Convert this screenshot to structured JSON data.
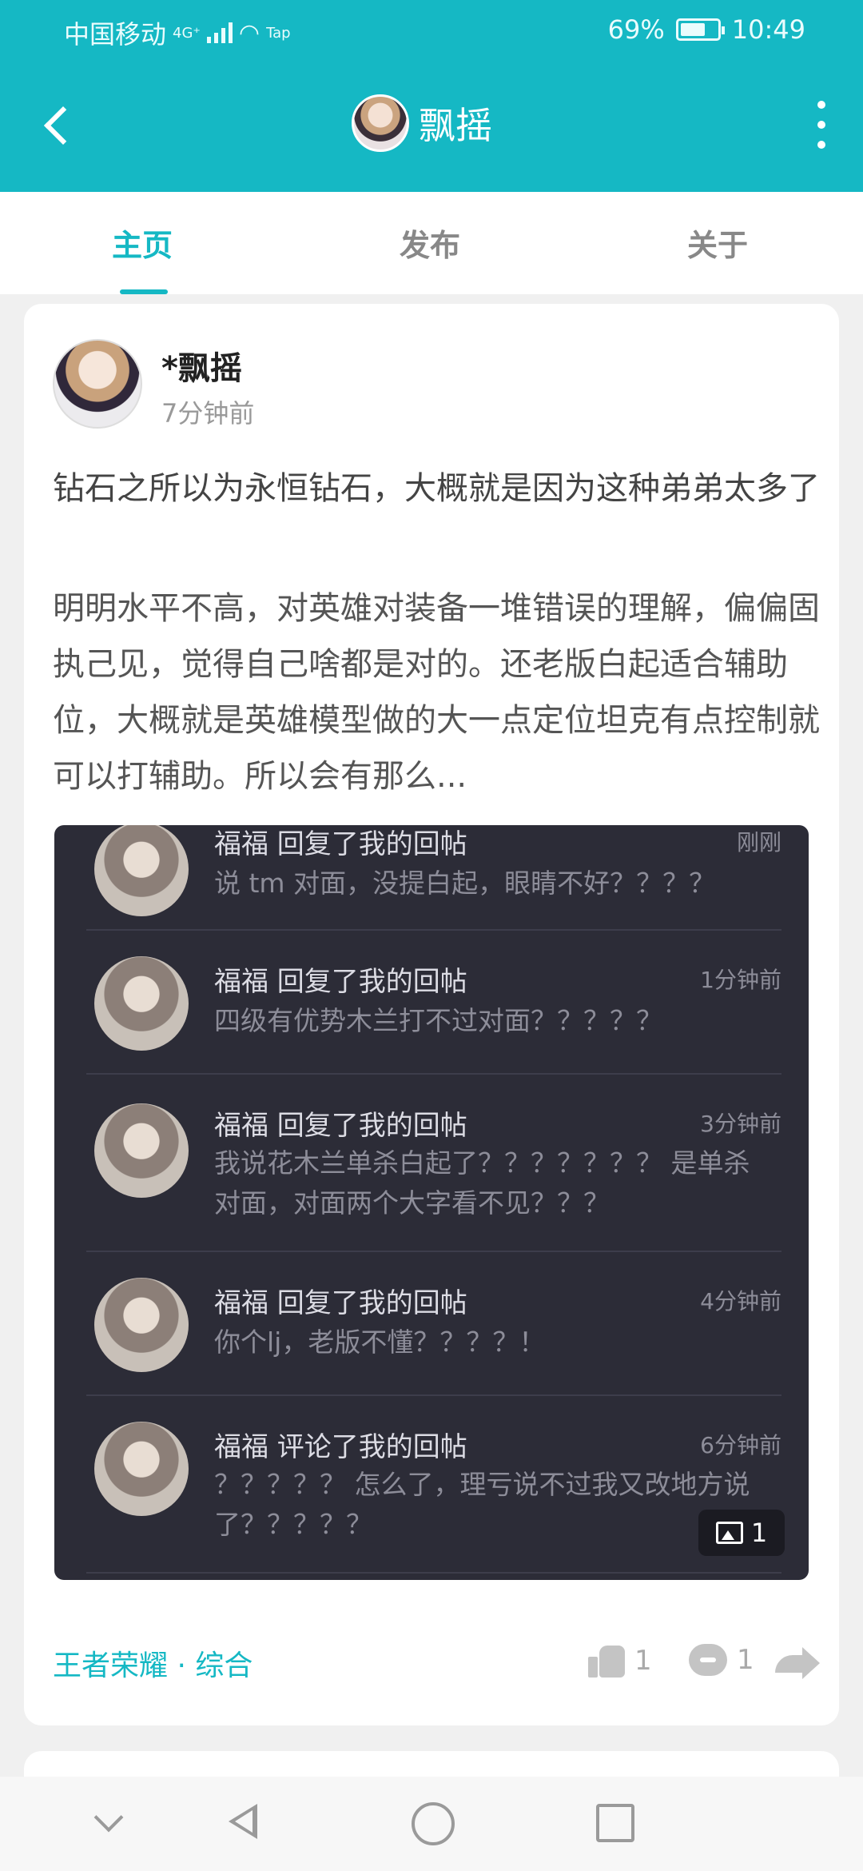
{
  "status_bar": {
    "carrier": "中国移动",
    "network": "4G⁺",
    "tap_label": "Tap",
    "battery_text": "69%",
    "battery_level": 0.69,
    "time": "10:49"
  },
  "app_bar": {
    "title": "飘摇",
    "back_icon": "chevron-left-icon",
    "more_icon": "more-vertical-icon"
  },
  "tabs": [
    {
      "label": "主页",
      "active": true
    },
    {
      "label": "发布",
      "active": false
    },
    {
      "label": "关于",
      "active": false
    }
  ],
  "post": {
    "author": "*飘摇",
    "time": "7分钟前",
    "title": "钻石之所以为永恒钻石，大概就是因为这种弟弟太多了",
    "body": "明明水平不高，对英雄对装备一堆错误的理解，偏偏固执己见，觉得自己啥都是对的。还老版白起适合辅助位，大概就是英雄模型做的大一点定位坦克有点控制就可以打辅助。所以会有那么...",
    "screenshot": {
      "items": [
        {
          "name": "福福 回复了我的回帖",
          "time": "刚刚",
          "text": "说 tm 对面，没提白起，眼睛不好？？？？"
        },
        {
          "name": "福福 回复了我的回帖",
          "time": "1分钟前",
          "text": "四级有优势木兰打不过对面？？？？？"
        },
        {
          "name": "福福 回复了我的回帖",
          "time": "3分钟前",
          "text": "我说花木兰单杀白起了？？？？？？？ 是单杀对面，对面两个大字看不见？？？"
        },
        {
          "name": "福福 回复了我的回帖",
          "time": "4分钟前",
          "text": "你个lj，老版不懂？？？？！"
        },
        {
          "name": "福福 评论了我的回帖",
          "time": "6分钟前",
          "text": "？？？？？ 怎么了，理亏说不过我又改地方说了？？？？？"
        }
      ],
      "image_count": "1"
    },
    "tag": "王者荣耀 · 综合",
    "likes": "1",
    "comments": "1"
  },
  "colors": {
    "accent": "#15b8c4",
    "dark_panel": "#2c2c37"
  }
}
